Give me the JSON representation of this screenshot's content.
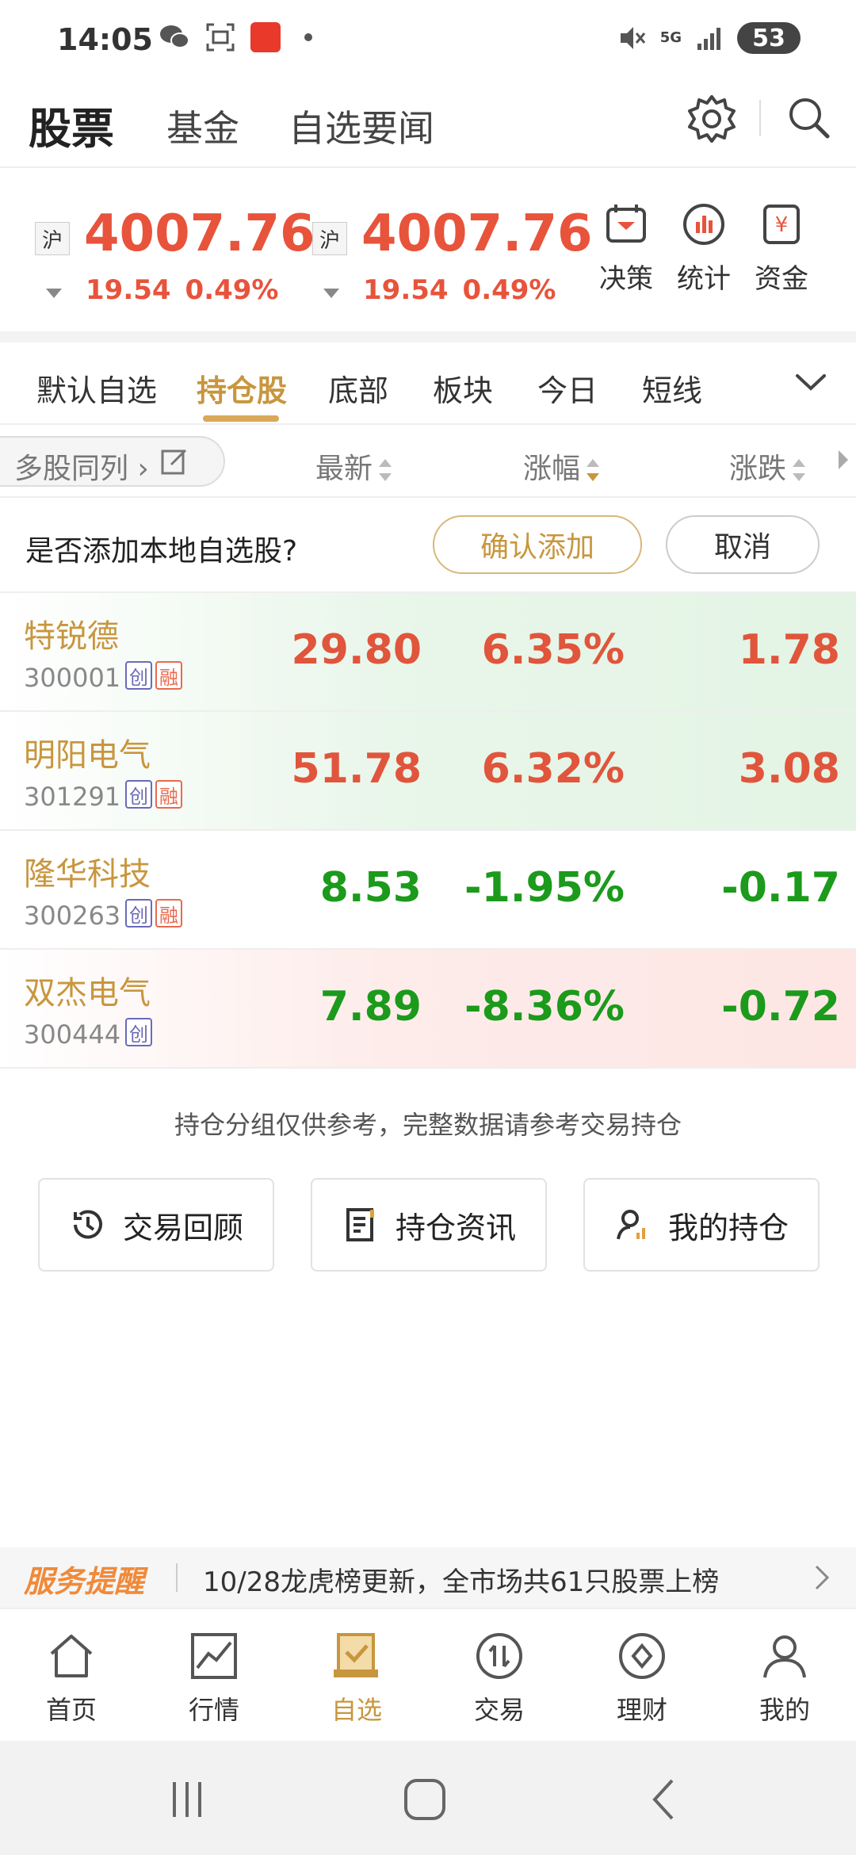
{
  "status_bar": {
    "time": "14:05",
    "network": "5G",
    "battery": "53"
  },
  "header": {
    "tabs": [
      "股票",
      "基金",
      "自选要闻"
    ]
  },
  "indexes": [
    {
      "market_badge": "沪",
      "value": "4007.76",
      "change": "19.54",
      "change_pct": "0.49%"
    },
    {
      "market_badge": "沪",
      "value": "4007.76",
      "change": "19.54",
      "change_pct": "0.49%"
    }
  ],
  "tools": [
    {
      "label": "决策",
      "icon": "decision-icon"
    },
    {
      "label": "统计",
      "icon": "stats-icon"
    },
    {
      "label": "资金",
      "icon": "funds-icon"
    }
  ],
  "group_tabs": [
    "默认自选",
    "持仓股",
    "底部",
    "板块",
    "今日",
    "短线"
  ],
  "active_group": "持仓股",
  "columns": {
    "multi": "多股同列",
    "latest": "最新",
    "pct": "涨幅",
    "change": "涨跌"
  },
  "prompt": {
    "text": "是否添加本地自选股?",
    "confirm": "确认添加",
    "cancel": "取消"
  },
  "stocks": [
    {
      "name": "特锐德",
      "code": "300001",
      "tags": [
        "创",
        "融"
      ],
      "price": "29.80",
      "pct": "6.35%",
      "change": "1.78",
      "direction": "up"
    },
    {
      "name": "明阳电气",
      "code": "301291",
      "tags": [
        "创",
        "融"
      ],
      "price": "51.78",
      "pct": "6.32%",
      "change": "3.08",
      "direction": "up"
    },
    {
      "name": "隆华科技",
      "code": "300263",
      "tags": [
        "创",
        "融"
      ],
      "price": "8.53",
      "pct": "-1.95%",
      "change": "-0.17",
      "direction": "down"
    },
    {
      "name": "双杰电气",
      "code": "300444",
      "tags": [
        "创"
      ],
      "price": "7.89",
      "pct": "-8.36%",
      "change": "-0.72",
      "direction": "down"
    }
  ],
  "disclaimer": "持仓分组仅供参考，完整数据请参考交易持仓",
  "actions": [
    {
      "label": "交易回顾",
      "icon": "history-icon"
    },
    {
      "label": "持仓资讯",
      "icon": "document-icon"
    },
    {
      "label": "我的持仓",
      "icon": "user-chart-icon"
    }
  ],
  "service": {
    "title": "服务提醒",
    "text": "10/28龙虎榜更新，全市场共61只股票上榜"
  },
  "bottom_nav": [
    {
      "label": "首页",
      "icon": "home-icon"
    },
    {
      "label": "行情",
      "icon": "market-icon"
    },
    {
      "label": "自选",
      "icon": "watchlist-icon"
    },
    {
      "label": "交易",
      "icon": "trade-icon"
    },
    {
      "label": "理财",
      "icon": "wealth-icon"
    },
    {
      "label": "我的",
      "icon": "profile-icon"
    }
  ],
  "active_nav": "自选",
  "colors": {
    "accent": "#c8963e",
    "up": "#e0553c",
    "down": "#1b9a1b",
    "service": "#f08a3a"
  }
}
